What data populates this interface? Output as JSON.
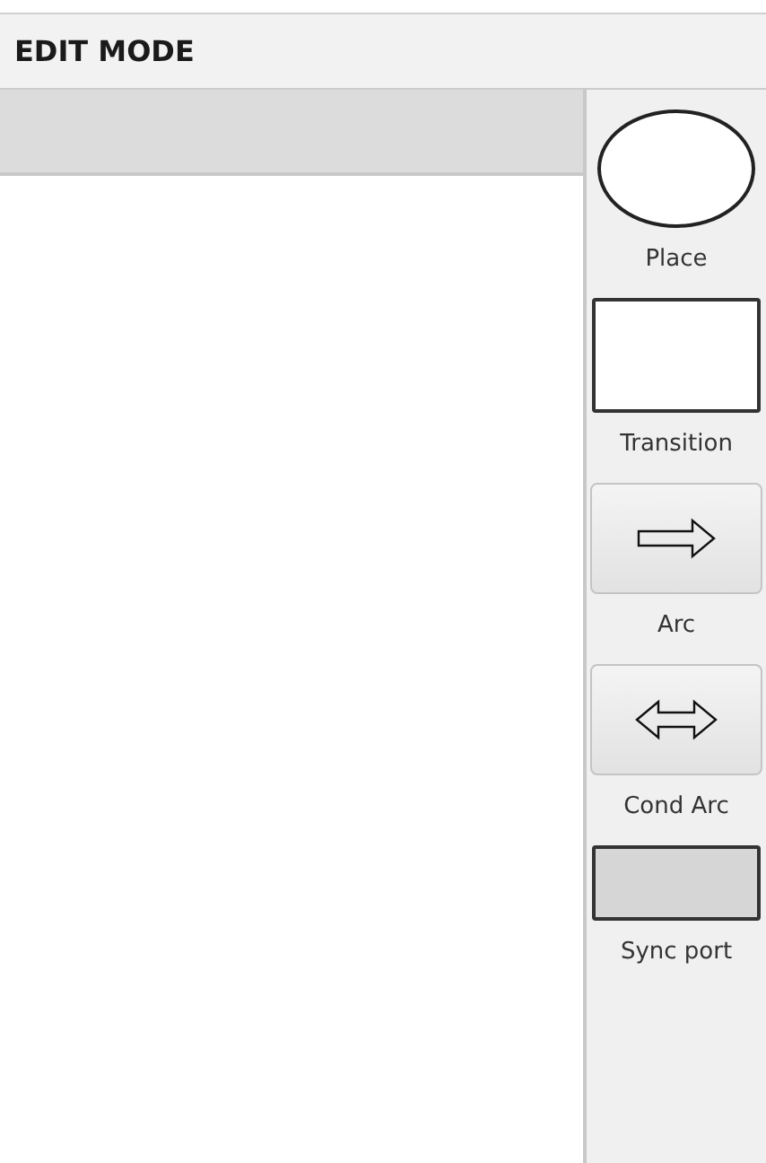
{
  "header": {
    "title": "EDIT MODE"
  },
  "palette": [
    {
      "kind": "place",
      "label": "Place"
    },
    {
      "kind": "transition",
      "label": "Transition"
    },
    {
      "kind": "arc",
      "label": "Arc"
    },
    {
      "kind": "cond_arc",
      "label": "Cond Arc"
    },
    {
      "kind": "sync_port",
      "label": "Sync port"
    }
  ]
}
